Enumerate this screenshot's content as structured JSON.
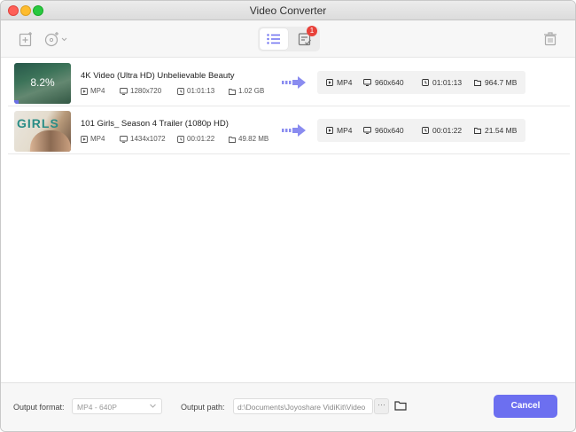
{
  "window": {
    "title": "Video Converter"
  },
  "toolbar": {
    "task_badge": "1"
  },
  "items": [
    {
      "name": "4K Video (Ultra HD) Unbelievable Beauty",
      "progress_text": "8.2%",
      "progress": 0.082,
      "src": {
        "format": "MP4",
        "resolution": "1280x720",
        "duration": "01:01:13",
        "size": "1.02 GB"
      },
      "out": {
        "format": "MP4",
        "resolution": "960x640",
        "duration": "01:01:13",
        "size": "964.7 MB"
      }
    },
    {
      "name": "101 Girls_ Season 4 Trailer (1080p HD)",
      "thumb_text": "GIRLS",
      "src": {
        "format": "MP4",
        "resolution": "1434x1072",
        "duration": "00:01:22",
        "size": "49.82 MB"
      },
      "out": {
        "format": "MP4",
        "resolution": "960x640",
        "duration": "00:01:22",
        "size": "21.54 MB"
      }
    }
  ],
  "footer": {
    "output_format_label": "Output format:",
    "output_format_value": "MP4 - 640P",
    "output_path_label": "Output path:",
    "output_path_value": "d:\\Documents\\Joyoshare VidiKit\\Video",
    "more_label": "···",
    "cancel_label": "Cancel"
  },
  "colors": {
    "accent": "#6c6ff0",
    "badge": "#e8413a"
  }
}
